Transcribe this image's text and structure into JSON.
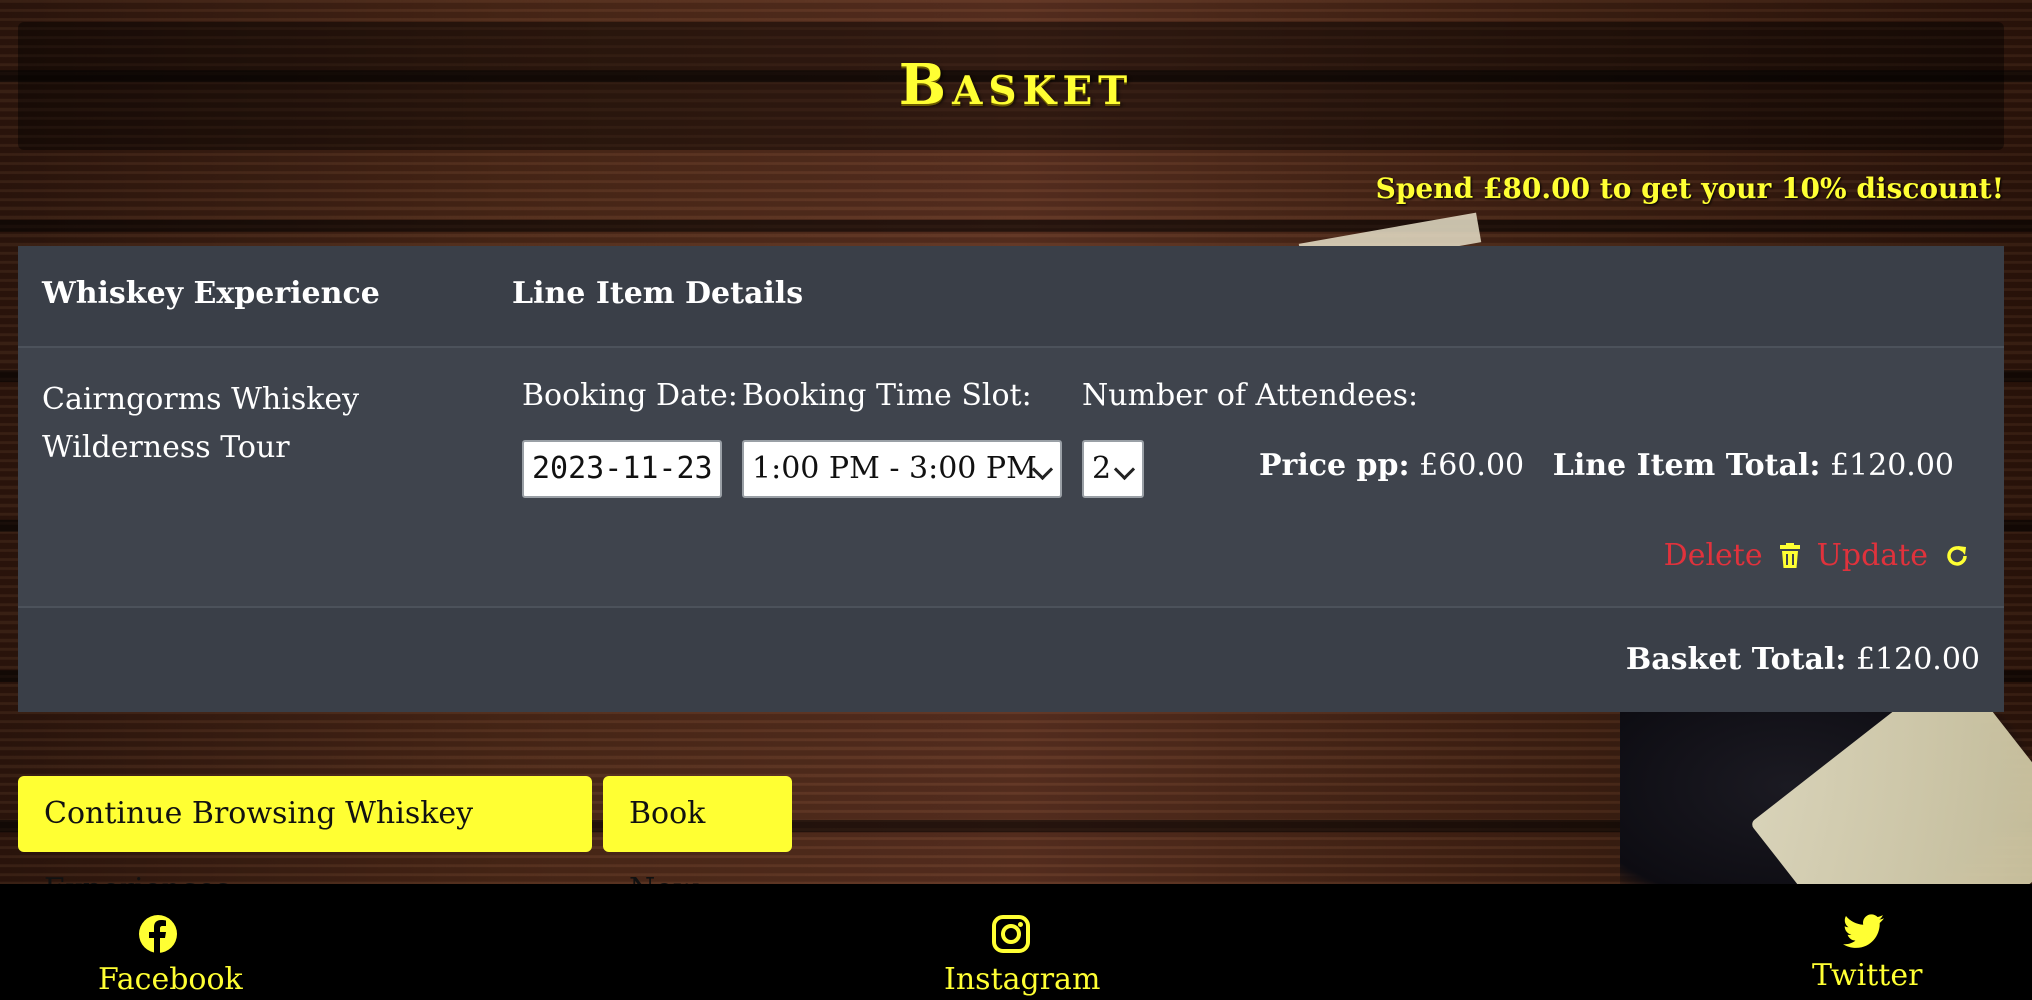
{
  "header": {
    "title": "Basket"
  },
  "discount_message": "Spend £80.00 to get your 10% discount!",
  "table": {
    "col_experience": "Whiskey Experience",
    "col_details": "Line Item Details"
  },
  "line_item": {
    "name": "Cairngorms Whiskey Wilderness Tour",
    "booking_date_label": "Booking Date:",
    "booking_date_value": "2023-11-23",
    "time_slot_label": "Booking Time Slot:",
    "time_slot_value": "1:00 PM - 3:00 PM",
    "attendees_label": "Number of Attendees:",
    "attendees_value": "2",
    "price_pp_label": "Price pp:",
    "price_pp_value": "£60.00",
    "line_total_label": "Line Item Total:",
    "line_total_value": "£120.00",
    "delete_label": "Delete",
    "update_label": "Update"
  },
  "basket_total": {
    "label": "Basket Total:",
    "value": "£120.00"
  },
  "buttons": {
    "continue": "Continue Browsing Whiskey Experiences",
    "book_now": "Book Now"
  },
  "footer": {
    "facebook": "Facebook",
    "instagram": "Instagram",
    "twitter": "Twitter"
  },
  "colors": {
    "accent": "#ffff33",
    "danger": "#e0323c",
    "panel": "#3a3f48"
  },
  "icons": [
    "trash-icon",
    "refresh-icon",
    "facebook-icon",
    "instagram-icon",
    "twitter-icon",
    "chevron-down-icon"
  ]
}
